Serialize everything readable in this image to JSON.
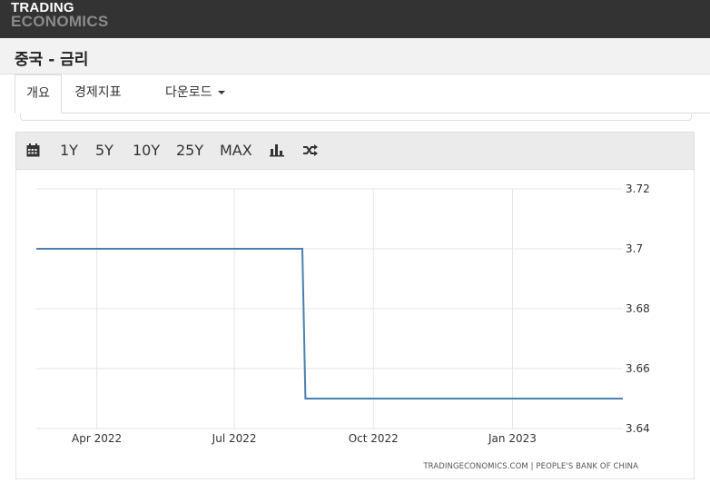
{
  "header": {
    "logo_line1": "TRADING",
    "logo_line2": "ECONOMICS"
  },
  "page_title": "중국 - 금리",
  "tabs": [
    {
      "label": "개요",
      "active": true
    },
    {
      "label": "경제지표",
      "active": false
    },
    {
      "label": "다운로드",
      "active": false,
      "has_caret": true
    }
  ],
  "toolbar": {
    "calendar_icon": "calendar-icon",
    "ranges": [
      "1Y",
      "5Y",
      "10Y",
      "25Y",
      "MAX"
    ],
    "chart_type_icon": "bar-chart-icon",
    "compare_icon": "shuffle-icon"
  },
  "chart_data": {
    "type": "line",
    "line_shape": "step",
    "series": [
      {
        "color": "#4a7fb0",
        "points": [
          {
            "x": "2022-02-20",
            "y": 3.7
          },
          {
            "x": "2022-08-15",
            "y": 3.7
          },
          {
            "x": "2022-08-17",
            "y": 3.65
          },
          {
            "x": "2023-03-15",
            "y": 3.65
          }
        ]
      }
    ],
    "x_range": [
      "2022-02-20",
      "2023-03-15"
    ],
    "x_ticks": [
      {
        "date": "2022-04-01",
        "label": "Apr 2022"
      },
      {
        "date": "2022-07-01",
        "label": "Jul 2022"
      },
      {
        "date": "2022-10-01",
        "label": "Oct 2022"
      },
      {
        "date": "2023-01-01",
        "label": "Jan 2023"
      }
    ],
    "y_ticks": [
      3.72,
      3.7,
      3.68,
      3.66,
      3.64
    ],
    "ylim": [
      3.64,
      3.72
    ],
    "y_axis_side": "right",
    "grid": true,
    "source": "TRADINGECONOMICS.COM | PEOPLE'S BANK OF CHINA"
  }
}
